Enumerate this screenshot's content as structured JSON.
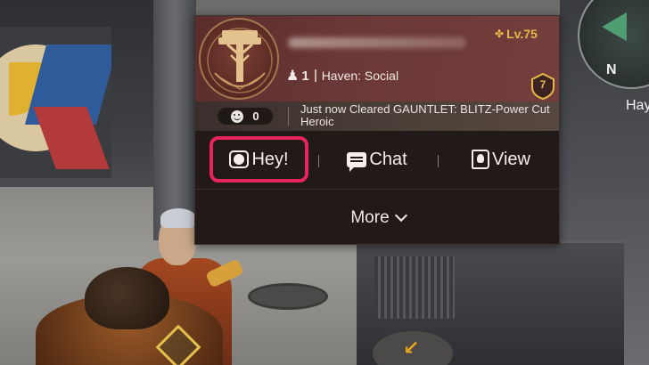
{
  "hud": {
    "minimap_compass": "N",
    "minimap_label": "Hay"
  },
  "player_card": {
    "level": "Lv.75",
    "member_count": "1",
    "haven": "Haven: Social",
    "badge_number": "7",
    "likes": "0",
    "activity": "Just now Cleared GAUNTLET: BLITZ-Power Cut Heroic",
    "name_obscured": true
  },
  "actions": {
    "hey_label": "Hey!",
    "chat_label": "Chat",
    "view_label": "View",
    "more_label": "More"
  },
  "icons": {
    "level": "winged-crest-icon",
    "members": "person-icon",
    "badge": "shield-badge-icon",
    "like": "smile-icon",
    "hey": "hey-emote-icon",
    "chat": "chat-bubble-icon",
    "view": "profile-book-icon",
    "more": "chevron-down-icon"
  },
  "colors": {
    "highlight": "#e8245c",
    "gold": "#e8b94a",
    "panel_bg": "#251d1b",
    "header_bg": "#6a3836"
  }
}
